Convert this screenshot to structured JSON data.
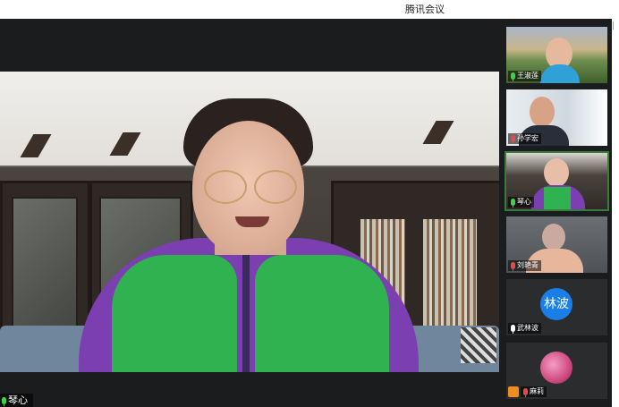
{
  "window": {
    "title": "腾讯会议"
  },
  "main_speaker": {
    "name": "琴心"
  },
  "participants": [
    {
      "name": "王淑莲"
    },
    {
      "name": "孙学宏"
    },
    {
      "name": "琴心"
    },
    {
      "name": "刘艳青"
    },
    {
      "name": "武林波",
      "avatar_text": "林波"
    },
    {
      "name": "麻莉"
    }
  ],
  "colors": {
    "accent_green": "#3fd04e",
    "avatar_blue": "#1a7ee6",
    "muted_red": "#e34a4a"
  }
}
